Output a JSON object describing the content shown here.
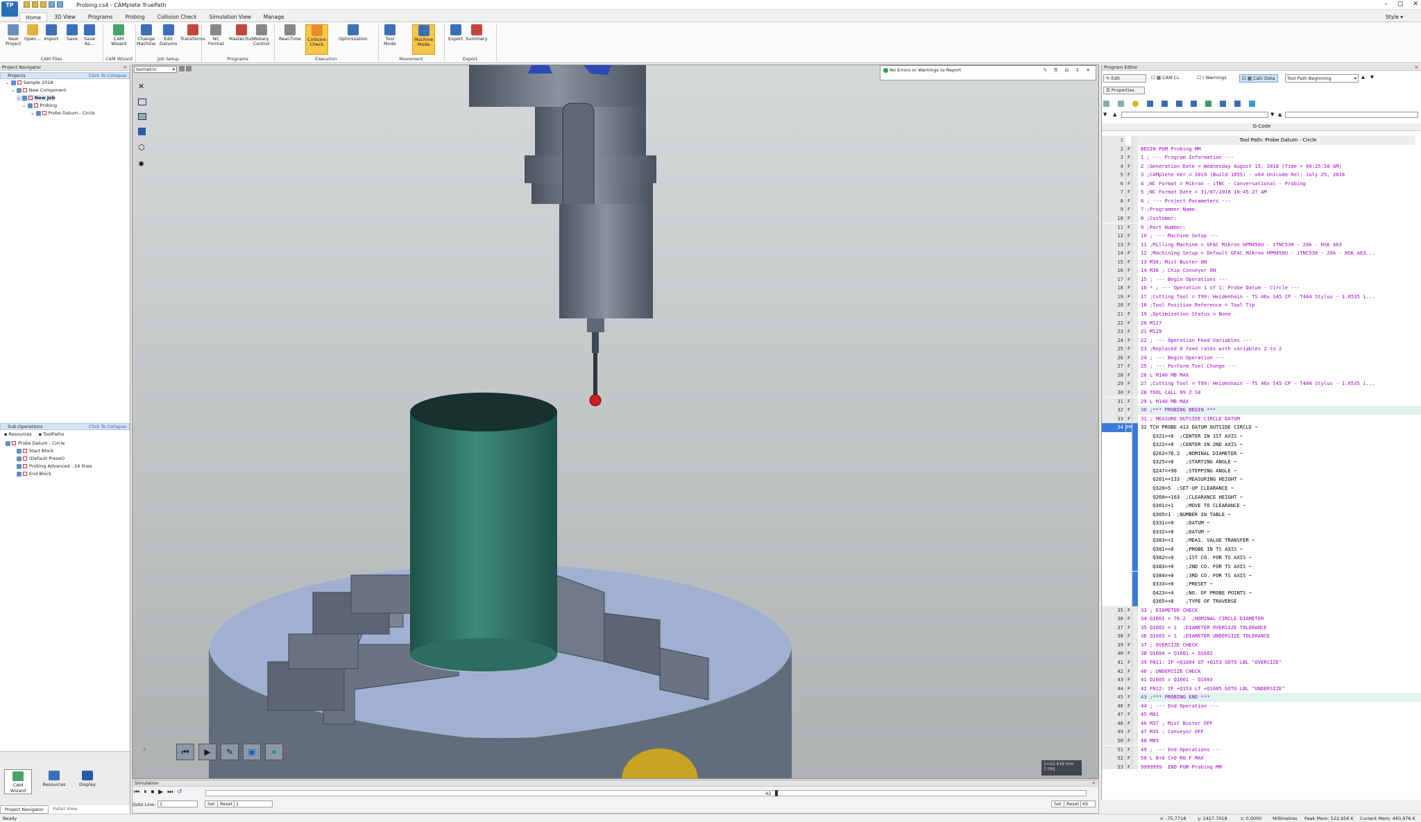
{
  "window": {
    "title": "Probing.cs4 - CAMplete TruePath",
    "logo_text": "TP",
    "style_label": "Style"
  },
  "ribbon": {
    "tabs": [
      "Home",
      "3D View",
      "Programs",
      "Probing",
      "Collision Check",
      "Simulation View",
      "Manage"
    ],
    "buttons": [
      {
        "label": "New\nProject"
      },
      {
        "label": "Open..."
      },
      {
        "label": "Import"
      },
      {
        "label": "Save"
      },
      {
        "label": "Save\nAs..."
      },
      {
        "label": "CAM\nWizard"
      },
      {
        "label": "Change\nMachine"
      },
      {
        "label": "Edit\nDatums"
      },
      {
        "label": "Transforms"
      },
      {
        "label": "NC\nFormat"
      },
      {
        "label": "Master/Sub"
      },
      {
        "label": "Rotary\nControl"
      },
      {
        "label": "Real-Time"
      },
      {
        "label": "Collision\nCheck"
      },
      {
        "label": "Optimization"
      },
      {
        "label": "Tool\nMode"
      },
      {
        "label": "Machine\nMode"
      },
      {
        "label": "Export"
      },
      {
        "label": "Summary"
      }
    ],
    "groups": [
      "CAM Files",
      "CAM Wizard",
      "Job Setup",
      "Programs",
      "Execution",
      "Movement",
      "Export"
    ]
  },
  "project_navigator": {
    "title": "Project Navigator",
    "projects_header": "Projects",
    "collapse": "Click To Collapse",
    "tree": [
      "Sample 2018",
      "New Component",
      "New Job",
      "Probing",
      "Probe Datum - Circle"
    ],
    "subops_header": "Sub-Operations",
    "subops_tabs": [
      "Resources",
      "ToolPaths"
    ],
    "subops_tree": [
      "Probe Datum - Circle",
      "Start Block",
      "(Default Preset)",
      "Probing Advanced : 24 lines",
      "End Block"
    ],
    "bottom_buttons": [
      "CAM Wizard",
      "Resources",
      "Display"
    ],
    "bottom_tabs": [
      "Project Navigator",
      "Pallet View"
    ]
  },
  "viewport": {
    "view_select": "Isometric",
    "status_message": "No Errors or Warnings to Report",
    "scale_readout": "1=22.416 mm",
    "fps_readout": "7 FPS"
  },
  "program_editor": {
    "title": "Program Editor",
    "toolbar": {
      "edit": "Edit",
      "cam_cl": "CAM CL",
      "warnings": "Warnings",
      "calc_data": "Calc Data",
      "tool_path_select": "Tool Path Beginning",
      "properties": "Properties"
    },
    "column_header": "G-Code",
    "lines": [
      {
        "n": "1",
        "f": "",
        "t": "Tool Path: Probe Datum - Circle",
        "c": "#000",
        "center": true
      },
      {
        "n": "2",
        "f": "F",
        "t": "BEGIN PGM Probing MM",
        "c": "#a000c8"
      },
      {
        "n": "3",
        "f": "F",
        "t": "1 ; --- Program Information ---",
        "c": "#a000c8"
      },
      {
        "n": "4",
        "f": "F",
        "t": "2 ;Generation Date = Wednesday August 15, 2018 (Time = 09:25:58 AM)",
        "c": "#a000c8"
      },
      {
        "n": "5",
        "f": "F",
        "t": "3 ;CAMplete Ver = 2019 (Build 1855) - x64 Unicode Rel: July 25, 2018",
        "c": "#a000c8"
      },
      {
        "n": "6",
        "f": "F",
        "t": "4 ;NC Format = Mikron - iTNC - Conversational - Probing",
        "c": "#a000c8"
      },
      {
        "n": "7",
        "f": "F",
        "t": "5 ;NC Format Date = 31/07/2018 10:45:27 AM",
        "c": "#a000c8"
      },
      {
        "n": "8",
        "f": "F",
        "t": "6 ; --- Project Parameters ---",
        "c": "#a000c8"
      },
      {
        "n": "9",
        "f": "F",
        "t": "7 ;Programmer Name:",
        "c": "#a000c8"
      },
      {
        "n": "10",
        "f": "F",
        "t": "8 ;Customer:",
        "c": "#a000c8"
      },
      {
        "n": "11",
        "f": "F",
        "t": "9 ;Part Number:",
        "c": "#a000c8"
      },
      {
        "n": "12",
        "f": "F",
        "t": "10 ; --- Machine Setup ---",
        "c": "#a000c8"
      },
      {
        "n": "13",
        "f": "F",
        "t": "11 ;Milling Machine = GFAC Mikron HPM450U - iTNC530 - 20k - HSK A63",
        "c": "#a000c8"
      },
      {
        "n": "14",
        "f": "F",
        "t": "12 ;Machining Setup = Default GFAC Mikron HPM450U - iTNC530 - 20k - HSK A63...",
        "c": "#a000c8"
      },
      {
        "n": "15",
        "f": "F",
        "t": "13 M38; Mist Buster ON",
        "c": "#a000c8"
      },
      {
        "n": "16",
        "f": "F",
        "t": "14 M36 ; Chip Conveyor ON",
        "c": "#a000c8"
      },
      {
        "n": "17",
        "f": "F",
        "t": "15 ; --- Begin Operations ---",
        "c": "#a000c8"
      },
      {
        "n": "18",
        "f": "F",
        "t": "16 * ; --- Operation 1 of 1: Probe Datum - Circle ---",
        "c": "#a000c8"
      },
      {
        "n": "19",
        "f": "F",
        "t": "17 ;Cutting Tool = T99: Heidenhain - TS 46x S45 CP - T404 Stylus - 1.6535 i...",
        "c": "#a000c8"
      },
      {
        "n": "20",
        "f": "F",
        "t": "18 ;Tool Position Reference = Tool Tip",
        "c": "#a000c8"
      },
      {
        "n": "21",
        "f": "F",
        "t": "19 ;Optimization Status = None",
        "c": "#a000c8"
      },
      {
        "n": "22",
        "f": "F",
        "t": "20 M127",
        "c": "#a000c8"
      },
      {
        "n": "23",
        "f": "F",
        "t": "21 M129",
        "c": "#a000c8"
      },
      {
        "n": "24",
        "f": "F",
        "t": "22 ; --- Operation Feed Variables ---",
        "c": "#a000c8"
      },
      {
        "n": "25",
        "f": "F",
        "t": "23 ;Replaced 0 feed rates with variables 2 to 2",
        "c": "#a000c8"
      },
      {
        "n": "26",
        "f": "F",
        "t": "24 ; --- Begin Operation ---",
        "c": "#a000c8"
      },
      {
        "n": "27",
        "f": "F",
        "t": "25 ; --- Perform Tool Change ---",
        "c": "#a000c8"
      },
      {
        "n": "28",
        "f": "F",
        "t": "26 L M140 MB MAX",
        "c": "#a000c8"
      },
      {
        "n": "29",
        "f": "F",
        "t": "27 ;Cutting Tool = T99: Heidenhain - TS 46x S45 CP - T404 Stylus - 1.6535 i...",
        "c": "#a000c8"
      },
      {
        "n": "30",
        "f": "F",
        "t": "28 TOOL CALL 99 Z S0",
        "c": "#a000c8"
      },
      {
        "n": "31",
        "f": "F",
        "t": "29 L M140 MB MAX",
        "c": "#a000c8"
      },
      {
        "n": "32",
        "f": "F",
        "t": "30 ;*** PROBING BEGIN ***",
        "c": "#a000c8",
        "hl": true
      },
      {
        "n": "33",
        "f": "F",
        "t": "31 ; MEASURE OUTSIDE CIRCLE DATUM",
        "c": "#a000c8"
      },
      {
        "n": "34",
        "f": "PR",
        "t": "32 TCH PROBE 413 DATUM OUTSIDE CIRCLE ~",
        "c": "#000",
        "sel": true
      },
      {
        "n": "",
        "f": "",
        "t": "    Q321=+0  ;CENTER IN 1ST AXIS ~",
        "c": "#000",
        "sel": true
      },
      {
        "n": "",
        "f": "",
        "t": "    Q322=+0  ;CENTER IN 2ND AXIS ~",
        "c": "#000",
        "sel": true
      },
      {
        "n": "",
        "f": "",
        "t": "    Q262=76.2  ;NOMINAL DIAMETER ~",
        "c": "#000",
        "sel": true
      },
      {
        "n": "",
        "f": "",
        "t": "    Q325=+0    ;STARTING ANGLE ~",
        "c": "#000",
        "sel": true
      },
      {
        "n": "",
        "f": "",
        "t": "    Q247=+90   ;STEPPING ANGLE ~",
        "c": "#000",
        "sel": true
      },
      {
        "n": "",
        "f": "",
        "t": "    Q261=+133  ;MEASURING HEIGHT ~",
        "c": "#000",
        "sel": true
      },
      {
        "n": "",
        "f": "",
        "t": "    Q320=5  ;SET-UP CLEARANCE ~",
        "c": "#000",
        "sel": true
      },
      {
        "n": "",
        "f": "",
        "t": "    Q260=+163  ;CLEARANCE HEIGHT ~",
        "c": "#000",
        "sel": true
      },
      {
        "n": "",
        "f": "",
        "t": "    Q301=+1    ;MOVE TO CLEARANCE ~",
        "c": "#000",
        "sel": true
      },
      {
        "n": "",
        "f": "",
        "t": "    Q305=1  ;NUMBER IN TABLE ~",
        "c": "#000",
        "sel": true
      },
      {
        "n": "",
        "f": "",
        "t": "    Q331=+0    ;DATUM ~",
        "c": "#000",
        "sel": true
      },
      {
        "n": "",
        "f": "",
        "t": "    Q332=+0    ;DATUM ~",
        "c": "#000",
        "sel": true
      },
      {
        "n": "",
        "f": "",
        "t": "    Q303=+1    ;MEAS. VALUE TRANSFER ~",
        "c": "#000",
        "sel": true
      },
      {
        "n": "",
        "f": "",
        "t": "    Q381=+0    ;PROBE IN TS AXIS ~",
        "c": "#000",
        "sel": true
      },
      {
        "n": "",
        "f": "",
        "t": "    Q382=+0    ;1ST CO. FOR TS AXIS ~",
        "c": "#000",
        "sel": true
      },
      {
        "n": "",
        "f": "",
        "t": "    Q383=+0    ;2ND CO. FOR TS AXIS ~",
        "c": "#000",
        "sel": true
      },
      {
        "n": "",
        "f": "",
        "t": "    Q384=+0    ;3RD CO. FOR TS AXIS ~",
        "c": "#000",
        "sel": true
      },
      {
        "n": "",
        "f": "",
        "t": "    Q333=+0    ;PRESET ~",
        "c": "#000",
        "sel": true
      },
      {
        "n": "",
        "f": "",
        "t": "    Q423=+4    ;NO. OF PROBE POINTS ~",
        "c": "#000",
        "sel": true
      },
      {
        "n": "",
        "f": "",
        "t": "    Q365=+0    ;TYPE OF TRAVERSE",
        "c": "#000",
        "sel": true
      },
      {
        "n": "35",
        "f": "F",
        "t": "33 ; DIAMETER CHECK",
        "c": "#a000c8"
      },
      {
        "n": "36",
        "f": "F",
        "t": "34 Q1601 = 76.2  ;NOMINAL CIRCLE DIAMETER",
        "c": "#a000c8"
      },
      {
        "n": "37",
        "f": "F",
        "t": "35 Q1602 = 1  ;DIAMETER OVERSIZE TOLERANCE",
        "c": "#a000c8"
      },
      {
        "n": "38",
        "f": "F",
        "t": "36 Q1603 = 1  ;DIAMETER UNDERSIZE TOLERANCE",
        "c": "#a000c8"
      },
      {
        "n": "39",
        "f": "F",
        "t": "37 ; OVERSIZE CHECK",
        "c": "#a000c8"
      },
      {
        "n": "40",
        "f": "F",
        "t": "38 Q1604 = Q1601 + Q1602",
        "c": "#a000c8"
      },
      {
        "n": "41",
        "f": "F",
        "t": "39 FN11: IF +Q1604 GT +Q153 GOTO LBL \"OVERSIZE\"",
        "c": "#a000c8"
      },
      {
        "n": "42",
        "f": "F",
        "t": "40 ; UNDERSIZE CHECK",
        "c": "#a000c8"
      },
      {
        "n": "43",
        "f": "F",
        "t": "41 Q1605 = Q1601 - Q1603",
        "c": "#a000c8"
      },
      {
        "n": "44",
        "f": "F",
        "t": "42 FN12: IF +Q153 LT +Q1605 GOTO LBL \"UNDERSIZE\"",
        "c": "#a000c8"
      },
      {
        "n": "45",
        "f": "F",
        "t": "43 ;*** PROBING END ***",
        "c": "#a000c8",
        "hl": true
      },
      {
        "n": "46",
        "f": "F",
        "t": "44 ; --- End Operation ---",
        "c": "#a000c8"
      },
      {
        "n": "47",
        "f": "F",
        "t": "45 M01",
        "c": "#a000c8"
      },
      {
        "n": "48",
        "f": "F",
        "t": "46 M37 ; Mist Buster OFF",
        "c": "#a000c8"
      },
      {
        "n": "49",
        "f": "F",
        "t": "47 M35 ; Conveyor OFF",
        "c": "#a000c8"
      },
      {
        "n": "50",
        "f": "F",
        "t": "48 M05",
        "c": "#a000c8"
      },
      {
        "n": "51",
        "f": "F",
        "t": "49 ; --- End Operations ---",
        "c": "#a000c8"
      },
      {
        "n": "52",
        "f": "F",
        "t": "50 L B+0 C+0 R0 F MAX",
        "c": "#a000c8"
      },
      {
        "n": "53",
        "f": "F",
        "t": "9999999  END PGM Probing MM",
        "c": "#a000c8"
      }
    ]
  },
  "simulation": {
    "title": "Simulation",
    "goto_line_label": "Goto Line:",
    "goto_line_value": "1",
    "set_label": "Set",
    "reset_label": "Reset",
    "reset_value": "1",
    "position_value": "42",
    "set2_label": "Set",
    "reset2_label": "Reset",
    "reset2_value": "65"
  },
  "statusbar": {
    "ready": "Ready",
    "x": "x: -75.7718",
    "y": "y: 1427.7018",
    "z": "z: 0.0000",
    "units": "Millimetres",
    "peak_mem": "Peak Mem: 522,956 K",
    "current_mem": "Current Mem: 440,976 K"
  }
}
